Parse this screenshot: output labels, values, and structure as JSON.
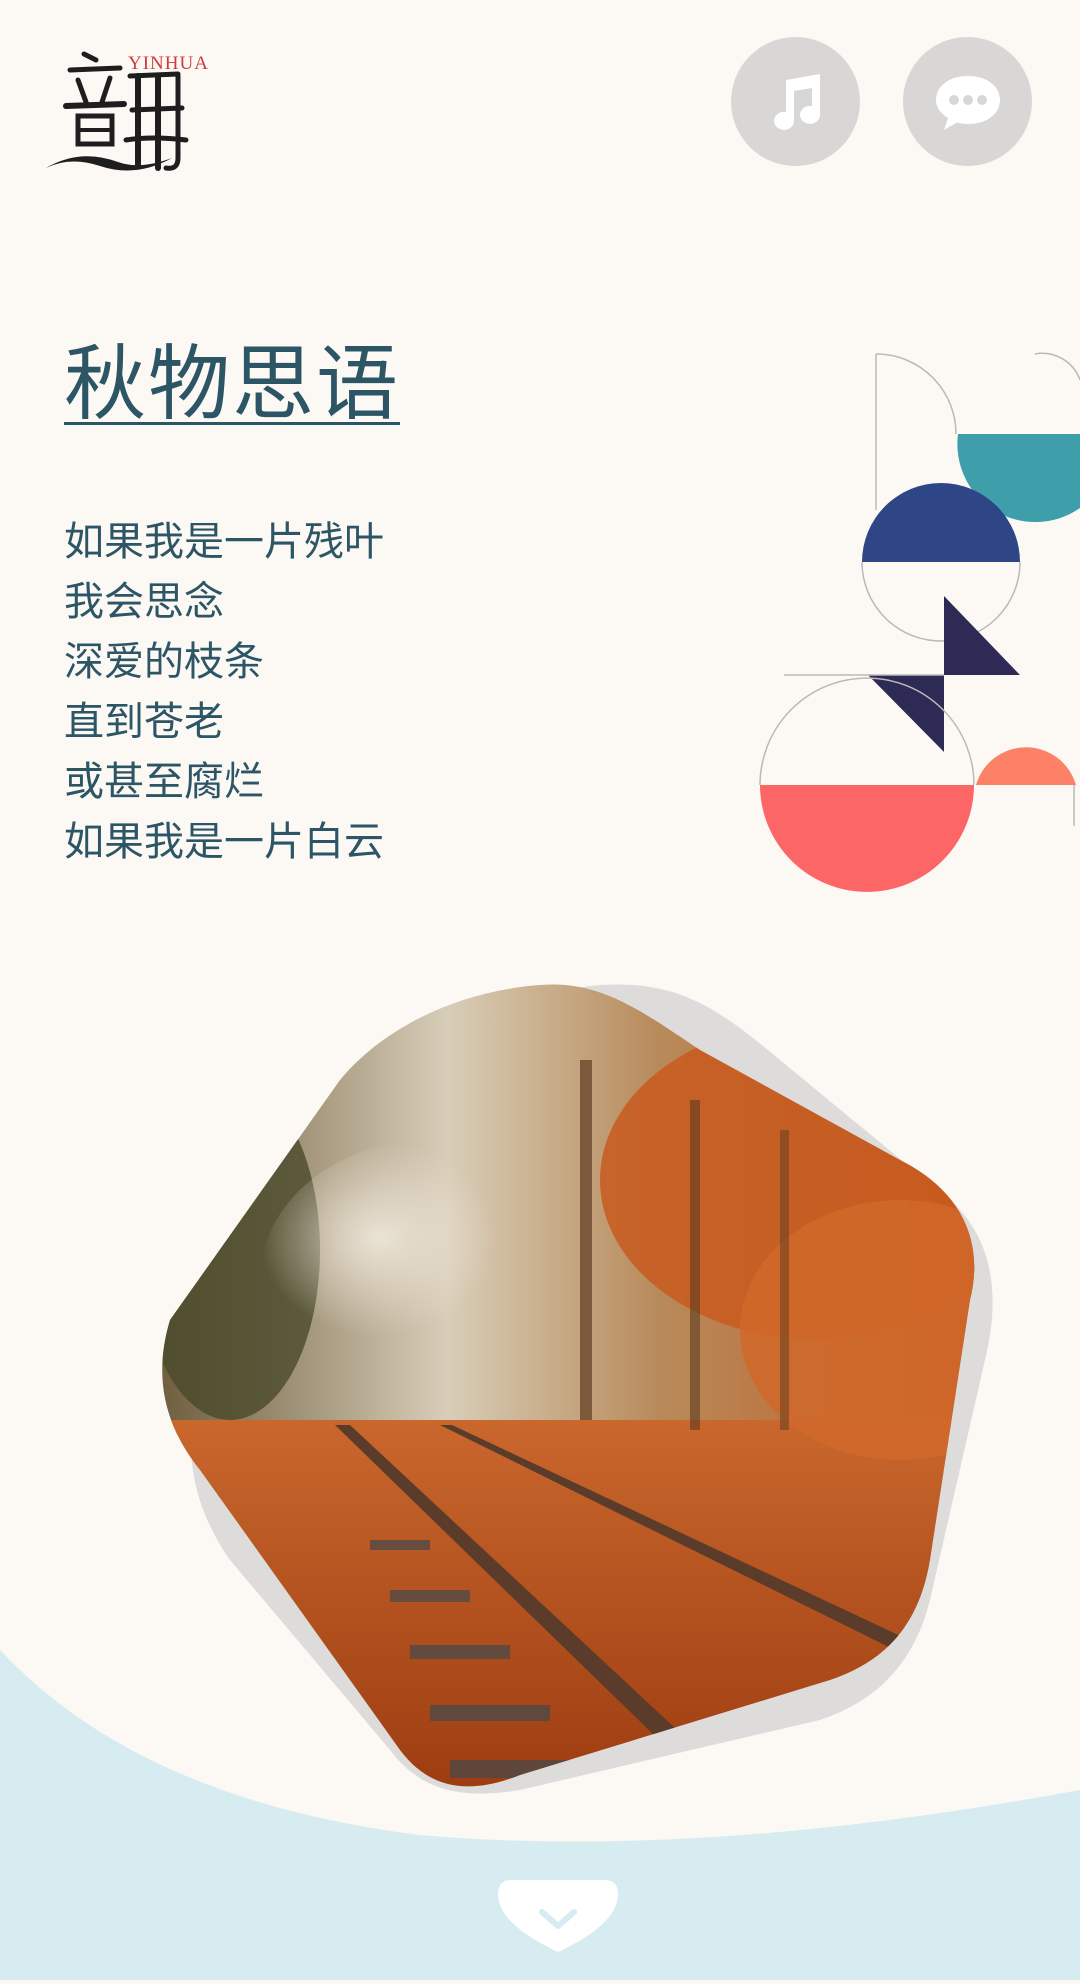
{
  "header": {
    "logo_text": "YINHUA",
    "logo_icon": "yinhua-calligraphy-logo",
    "music_button_icon": "music-note-icon",
    "chat_button_icon": "chat-bubble-icon"
  },
  "content": {
    "title": "秋物思语",
    "poem_lines": [
      "如果我是一片残叶",
      "我会思念",
      "深爱的枝条",
      "直到苍老",
      "或甚至腐烂",
      "如果我是一片白云"
    ]
  },
  "decoration": {
    "image_subject": "autumn-railway-photo",
    "scroll_icon": "chevron-down-icon"
  },
  "colors": {
    "background": "#fcf9f5",
    "text": "#2c5566",
    "teal": "#3e9ea9",
    "navy": "#2f4686",
    "dark_navy": "#2d2a55",
    "coral": "#fc6666",
    "salmon": "#fd8167",
    "wave": "#d6ecf1",
    "button_gray": "#d9d7d5"
  }
}
